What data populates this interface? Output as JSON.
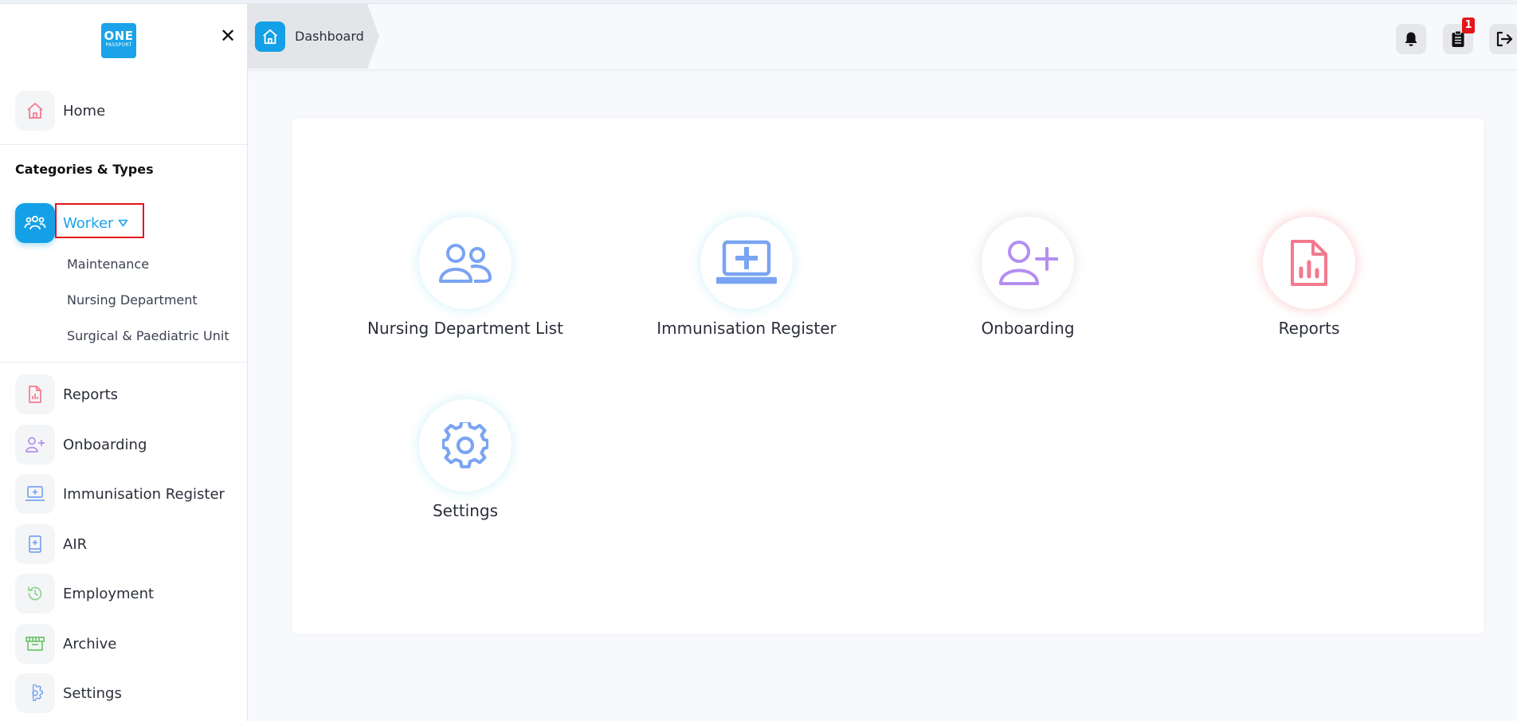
{
  "brand": {
    "logo_line1": "ONE",
    "logo_line2": "PASSPORT"
  },
  "sidebar": {
    "close_symbol": "✕",
    "home": {
      "label": "Home",
      "icon": "home-icon"
    },
    "section_title": "Categories & Types",
    "worker": {
      "label": "Worker",
      "icon": "users-icon"
    },
    "sub_items": [
      "Maintenance",
      "Nursing Department",
      "Surgical & Paediatric Unit"
    ],
    "items": [
      {
        "label": "Reports",
        "icon": "report-icon"
      },
      {
        "label": "Onboarding",
        "icon": "user-plus-icon"
      },
      {
        "label": "Immunisation Register",
        "icon": "laptop-plus-icon"
      },
      {
        "label": "AIR",
        "icon": "book-plus-icon"
      },
      {
        "label": "Employment",
        "icon": "history-icon"
      },
      {
        "label": "Archive",
        "icon": "archive-icon"
      },
      {
        "label": "Settings",
        "icon": "gear-icon"
      }
    ]
  },
  "header": {
    "breadcrumb": "Dashboard",
    "notification_count": "1"
  },
  "dashboard": {
    "tiles": [
      {
        "label": "Nursing Department List",
        "icon": "users-icon"
      },
      {
        "label": "Immunisation Register",
        "icon": "laptop-plus-icon"
      },
      {
        "label": "Onboarding",
        "icon": "user-plus-icon"
      },
      {
        "label": "Reports",
        "icon": "report-icon"
      },
      {
        "label": "Settings",
        "icon": "gear-icon"
      }
    ]
  },
  "colors": {
    "accent": "#1aa3e8",
    "tile_blue": "#7aa4f2",
    "tile_purple": "#b48ef0",
    "tile_red": "#f27a8e",
    "highlight": "#e3141c"
  }
}
